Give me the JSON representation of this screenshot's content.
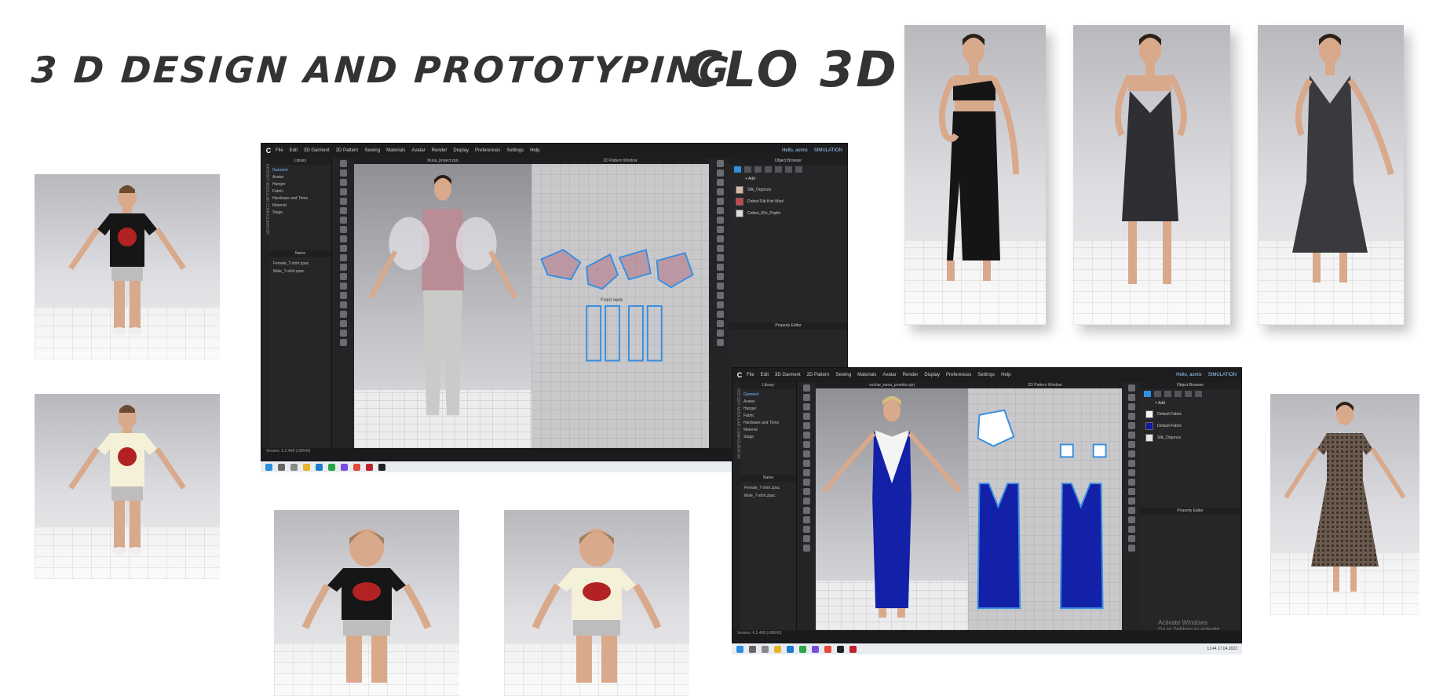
{
  "headline": "3 D DESIGN AND PROTOTYPING",
  "brand": "CLO 3D",
  "app": {
    "menu": [
      "File",
      "Edit",
      "3D Garment",
      "2D Pattern",
      "Sewing",
      "Materials",
      "Avatar",
      "Render",
      "Display",
      "Preferences",
      "Settings",
      "Help"
    ],
    "user": "Hello, asmix",
    "mode": "SIMULATION",
    "library_title": "Library",
    "library_tree": [
      "Garment",
      "Avatar",
      "Hanger",
      "Fabric",
      "Hardware and Trims",
      "Material",
      "Stage"
    ],
    "name_header": "Name",
    "files": [
      "Female_T-shirt.zpac",
      "Male_T-shirt.zpac"
    ],
    "vtabs": "HISTORY   MODULAR CONFIGURATOR",
    "pattern_window_title": "2D Pattern Window",
    "object_browser_title": "Object Browser",
    "add_label": "+ Add",
    "property_editor_title": "Property Editor",
    "version": "Version: 6.2.468 (r38643)"
  },
  "window1": {
    "view3d_title": "blusa_project.zprj",
    "fabrics": [
      {
        "name": "Silk_Organza",
        "color": "#d9b7a8"
      },
      {
        "name": "Dotted Rib Knit Wool",
        "color": "#c44a4a"
      },
      {
        "name": "Cotton_50s_Poplin",
        "color": "#dcdcdc"
      }
    ],
    "pattern_label": "Front neck"
  },
  "window2": {
    "view3d_title": "vechar_tama_proekto.zprj",
    "fabrics": [
      {
        "name": "Default Fabric",
        "color": "#f4f4f4"
      },
      {
        "name": "Default Fabric",
        "color": "#1219a3"
      },
      {
        "name": "Silk_Organza",
        "color": "#e6e6e6"
      }
    ],
    "watermark_title": "Activate Windows",
    "watermark_sub": "Go to Settings to activate Windows.",
    "clock_time": "11:44",
    "clock_date": "17.04.2022"
  },
  "colors": {
    "skin": "#d9a98c",
    "black_dress": "#151515",
    "charcoal_dress": "#2f2f33",
    "grey_dress": "#3a3a3e",
    "blue_gown": "#1320a8",
    "check_dress": "#6a5a4e",
    "tshirt_black": "#161616",
    "tshirt_cream": "#f4f1d8",
    "blouse": "#b98c96",
    "pants": "#c9cbc9",
    "pattern_outline": "#3a8fe0"
  }
}
